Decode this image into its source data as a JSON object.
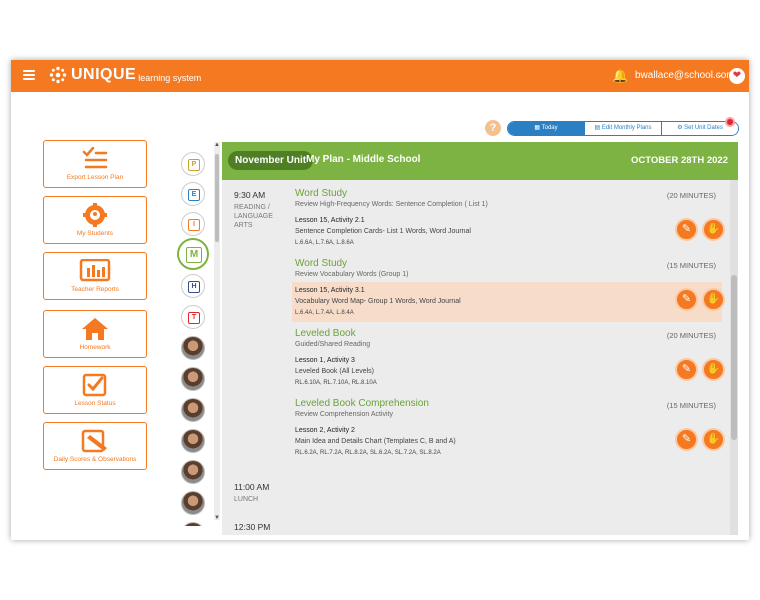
{
  "header": {
    "logo_word": "UNIQUE",
    "logo_sub": "learning system",
    "user_email": "bwallace@school.com"
  },
  "view_tabs": [
    "Today",
    "Edit Monthly Plans",
    "Set Unit Dates"
  ],
  "sidebar": [
    {
      "label": "Export Lesson Plan",
      "icon": "checklist-icon"
    },
    {
      "label": "My Students",
      "icon": "students-gear-icon"
    },
    {
      "label": "Teacher Reports",
      "icon": "bar-chart-icon"
    },
    {
      "label": "Homework",
      "icon": "house-icon"
    },
    {
      "label": "Lesson Status",
      "icon": "checkbox-icon"
    },
    {
      "label": "Daily Scores & Observations",
      "icon": "clipboard-pencil-icon"
    }
  ],
  "level_icons": [
    {
      "letter": "P",
      "color": "#c9a227"
    },
    {
      "letter": "E",
      "color": "#2b80c4"
    },
    {
      "letter": "I",
      "color": "#f47920"
    },
    {
      "letter": "M",
      "color": "#7cb342"
    },
    {
      "letter": "H",
      "color": "#3a4a8a"
    },
    {
      "letter": "T",
      "color": "#e3242b"
    }
  ],
  "plan": {
    "unit": "November Unit",
    "name": "My Plan - Middle School",
    "date": "OCTOBER 28TH 2022",
    "block": {
      "time": "9:30 AM",
      "subject": "READING / LANGUAGE ARTS"
    },
    "activities": [
      {
        "title": "Word Study",
        "sub": "Review High-Frequency Words: Sentence Completion ( List 1)",
        "minutes": "(20 MINUTES)",
        "lesson": "Lesson 15, Activity 2.1",
        "desc": "Sentence Completion Cards- List 1 Words, Word Journal",
        "standards": "L.6.6A, L.7.6A, L.8.6A"
      },
      {
        "title": "Word Study",
        "sub": "Review Vocabulary Words (Group 1)",
        "minutes": "(15 MINUTES)",
        "lesson": "Lesson 15, Activity 3.1",
        "desc": "Vocabulary Word Map- Group 1 Words, Word Journal",
        "standards": "L.6.4A, L.7.4A, L.8.4A"
      },
      {
        "title": "Leveled Book",
        "sub": "Guided/Shared Reading",
        "minutes": "(20 MINUTES)",
        "lesson": "Lesson 1, Activity 3",
        "desc": "Leveled Book (All Levels)",
        "standards": "RL.6.10A, RL.7.10A, RL.8.10A"
      },
      {
        "title": "Leveled Book Comprehension",
        "sub": "Review Comprehension Activity",
        "minutes": "(15 MINUTES)",
        "lesson": "Lesson 2, Activity 2",
        "desc": "Main Idea and Details Chart (Templates C, B and A)",
        "standards": "RL.6.2A, RL.7.2A, RL.8.2A, SL.6.2A, SL.7.2A, SL.8.2A"
      }
    ],
    "later_blocks": [
      {
        "time": "11:00 AM",
        "subject": "LUNCH"
      },
      {
        "time": "12:30 PM",
        "subject": ""
      }
    ]
  }
}
